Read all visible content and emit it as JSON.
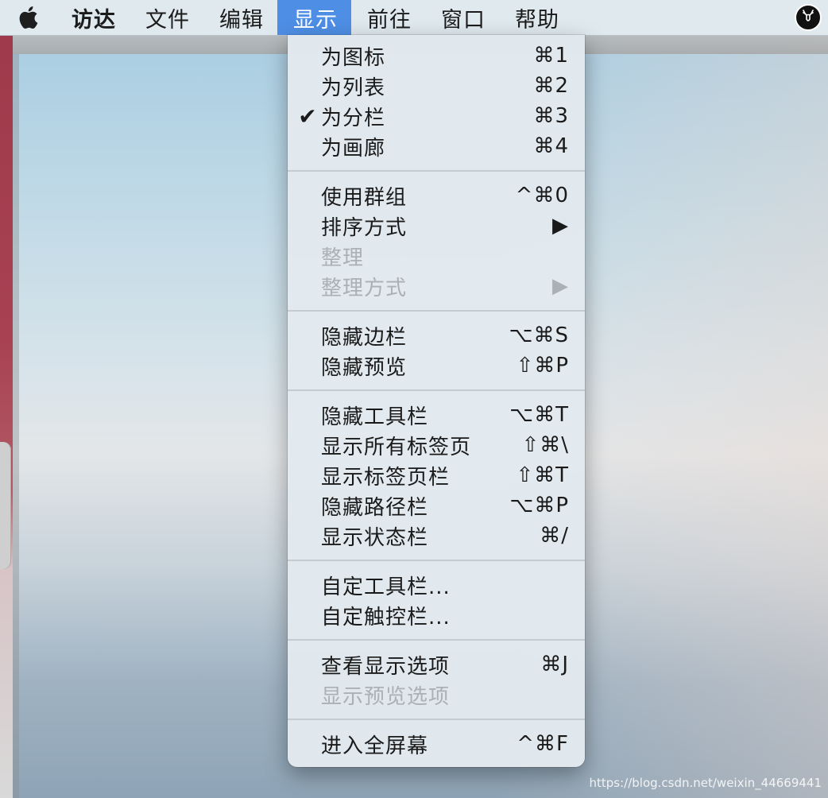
{
  "menubar": {
    "apple_icon": "",
    "items": [
      "访达",
      "文件",
      "编辑",
      "显示",
      "前往",
      "窗口",
      "帮助"
    ],
    "active_index": 3,
    "status_icon": "deer-icon"
  },
  "menu": {
    "items": [
      {
        "label": "为图标",
        "shortcut": "⌘1",
        "checked": false,
        "disabled": false
      },
      {
        "label": "为列表",
        "shortcut": "⌘2",
        "checked": false,
        "disabled": false
      },
      {
        "label": "为分栏",
        "shortcut": "⌘3",
        "checked": true,
        "disabled": false,
        "check": "✔"
      },
      {
        "label": "为画廊",
        "shortcut": "⌘4",
        "checked": false,
        "disabled": false
      },
      {
        "label": "使用群组",
        "shortcut": "^⌘0",
        "checked": false,
        "disabled": false
      },
      {
        "label": "排序方式",
        "shortcut": "▶",
        "checked": false,
        "disabled": false
      },
      {
        "label": "整理",
        "shortcut": "",
        "checked": false,
        "disabled": true
      },
      {
        "label": "整理方式",
        "shortcut": "▶",
        "checked": false,
        "disabled": true
      },
      {
        "label": "隐藏边栏",
        "shortcut": "⌥⌘S",
        "checked": false,
        "disabled": false
      },
      {
        "label": "隐藏预览",
        "shortcut": "⇧⌘P",
        "checked": false,
        "disabled": false
      },
      {
        "label": "隐藏工具栏",
        "shortcut": "⌥⌘T",
        "checked": false,
        "disabled": false
      },
      {
        "label": "显示所有标签页",
        "shortcut": "⇧⌘\\",
        "checked": false,
        "disabled": false
      },
      {
        "label": "显示标签页栏",
        "shortcut": "⇧⌘T",
        "checked": false,
        "disabled": false
      },
      {
        "label": "隐藏路径栏",
        "shortcut": "⌥⌘P",
        "checked": false,
        "disabled": false
      },
      {
        "label": "显示状态栏",
        "shortcut": "⌘/",
        "checked": false,
        "disabled": false
      },
      {
        "label": "自定工具栏...",
        "shortcut": "",
        "checked": false,
        "disabled": false
      },
      {
        "label": "自定触控栏...",
        "shortcut": "",
        "checked": false,
        "disabled": false
      },
      {
        "label": "查看显示选项",
        "shortcut": "⌘J",
        "checked": false,
        "disabled": false
      },
      {
        "label": "显示预览选项",
        "shortcut": "",
        "checked": false,
        "disabled": true
      },
      {
        "label": "进入全屏幕",
        "shortcut": "^⌘F",
        "checked": false,
        "disabled": false
      }
    ]
  },
  "watermark": "https://blog.csdn.net/weixin_44669441"
}
